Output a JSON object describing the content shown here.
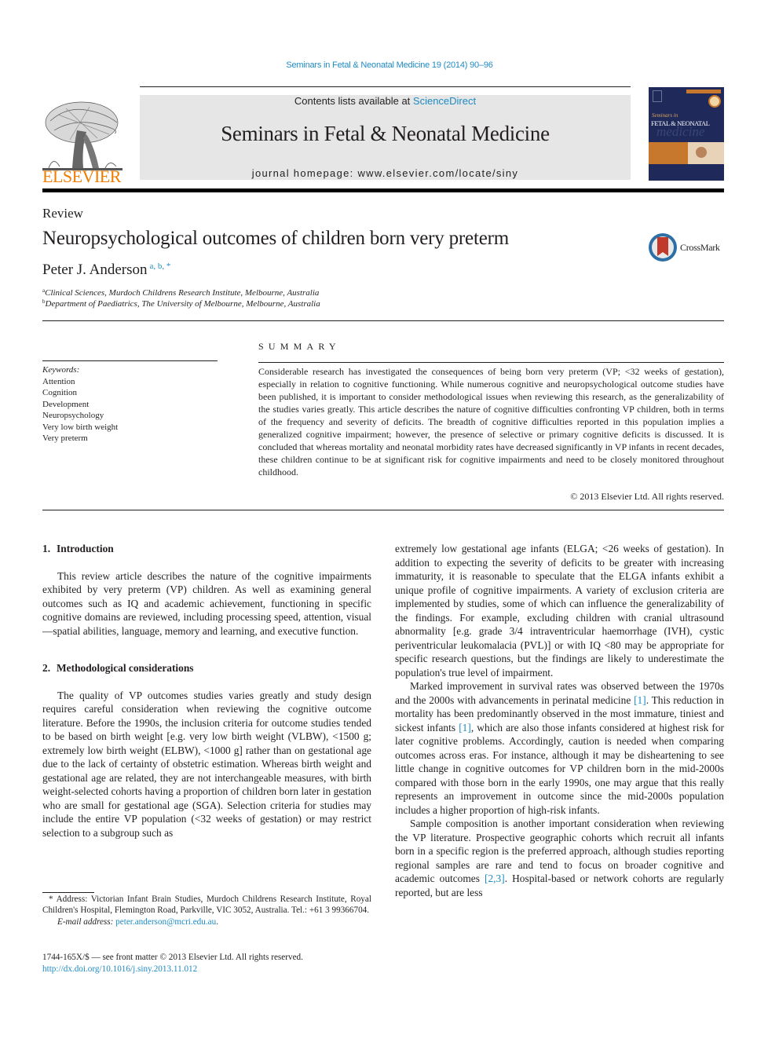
{
  "header": {
    "journal_reference": "Seminars in Fetal & Neonatal Medicine 19 (2014) 90–96",
    "contents_prefix": "Contents lists available at ",
    "contents_link": "ScienceDirect",
    "journal_title": "Seminars in Fetal & Neonatal Medicine",
    "homepage": "journal homepage: www.elsevier.com/locate/siny",
    "publisher_logo_text": "ELSEVIER",
    "cover": {
      "series_line": "Seminars in",
      "title_line": "FETAL & NEONATAL",
      "script_line": "medicine"
    },
    "colors": {
      "link": "#1e8bc3",
      "elsevier_orange": "#f07c00",
      "banner_gray": "#e6e6e6",
      "cover_navy": "#1f2a5a"
    }
  },
  "article": {
    "type": "Review",
    "title": "Neuropsychological outcomes of children born very preterm",
    "crossmark_label": "CrossMark",
    "author": "Peter J. Anderson",
    "author_marks": "a, b, *",
    "affiliations": [
      {
        "mark": "a",
        "text": "Clinical Sciences, Murdoch Childrens Research Institute, Melbourne, Australia"
      },
      {
        "mark": "b",
        "text": "Department of Paediatrics, The University of Melbourne, Melbourne, Australia"
      }
    ]
  },
  "summary": {
    "heading": "SUMMARY",
    "keywords_label": "Keywords:",
    "keywords": [
      "Attention",
      "Cognition",
      "Development",
      "Neuropsychology",
      "Very low birth weight",
      "Very preterm"
    ],
    "abstract": "Considerable research has investigated the consequences of being born very preterm (VP; <32 weeks of gestation), especially in relation to cognitive functioning. While numerous cognitive and neuropsychological outcome studies have been published, it is important to consider methodological issues when reviewing this research, as the generalizability of the studies varies greatly. This article describes the nature of cognitive difficulties confronting VP children, both in terms of the frequency and severity of deficits. The breadth of cognitive difficulties reported in this population implies a generalized cognitive impairment; however, the presence of selective or primary cognitive deficits is discussed. It is concluded that whereas mortality and neonatal morbidity rates have decreased significantly in VP infants in recent decades, these children continue to be at significant risk for cognitive impairments and need to be closely monitored throughout childhood.",
    "copyright": "© 2013 Elsevier Ltd. All rights reserved."
  },
  "body": {
    "sections": [
      {
        "number": "1.",
        "title": "Introduction",
        "paragraphs": [
          "This review article describes the nature of the cognitive impairments exhibited by very preterm (VP) children. As well as examining general outcomes such as IQ and academic achievement, functioning in specific cognitive domains are reviewed, including processing speed, attention, visual—spatial abilities, language, memory and learning, and executive function."
        ]
      },
      {
        "number": "2.",
        "title": "Methodological considerations",
        "paragraphs": [
          "The quality of VP outcomes studies varies greatly and study design requires careful consideration when reviewing the cognitive outcome literature. Before the 1990s, the inclusion criteria for outcome studies tended to be based on birth weight [e.g. very low birth weight (VLBW), <1500 g; extremely low birth weight (ELBW), <1000 g] rather than on gestational age due to the lack of certainty of obstetric estimation. Whereas birth weight and gestational age are related, they are not interchangeable measures, with birth weight-selected cohorts having a proportion of children born later in gestation who are small for gestational age (SGA). Selection criteria for studies may include the entire VP population (<32 weeks of gestation) or may restrict selection to a subgroup such as"
        ]
      }
    ],
    "right_column": {
      "p1": "extremely low gestational age infants (ELGA; <26 weeks of gestation). In addition to expecting the severity of deficits to be greater with increasing immaturity, it is reasonable to speculate that the ELGA infants exhibit a unique profile of cognitive impairments. A variety of exclusion criteria are implemented by studies, some of which can influence the generalizability of the findings. For example, excluding children with cranial ultrasound abnormality [e.g. grade 3/4 intraventricular haemorrhage (IVH), cystic periventricular leukomalacia (PVL)] or with IQ <80 may be appropriate for specific research questions, but the findings are likely to underestimate the population's true level of impairment.",
      "p2_a": "Marked improvement in survival rates was observed between the 1970s and the 2000s with advancements in perinatal medicine ",
      "p2_ref1": "[1]",
      "p2_b": ". This reduction in mortality has been predominantly observed in the most immature, tiniest and sickest infants ",
      "p2_ref2": "[1]",
      "p2_c": ", which are also those infants considered at highest risk for later cognitive problems. Accordingly, caution is needed when comparing outcomes across eras. For instance, although it may be disheartening to see little change in cognitive outcomes for VP children born in the mid-2000s compared with those born in the early 1990s, one may argue that this really represents an improvement in outcome since the mid-2000s population includes a higher proportion of high-risk infants.",
      "p3_a": "Sample composition is another important consideration when reviewing the VP literature. Prospective geographic cohorts which recruit all infants born in a specific region is the preferred approach, although studies reporting regional samples are rare and tend to focus on broader cognitive and academic outcomes ",
      "p3_ref": "[2,3]",
      "p3_b": ". Hospital-based or network cohorts are regularly reported, but are less"
    }
  },
  "footnote": {
    "mark": "*",
    "address": "Address: Victorian Infant Brain Studies, Murdoch Childrens Research Institute, Royal Children's Hospital, Flemington Road, Parkville, VIC 3052, Australia. Tel.: +61 3 99366704.",
    "email_label": "E-mail address:",
    "email": "peter.anderson@mcri.edu.au",
    "email_suffix": "."
  },
  "front_matter": {
    "issn_line": "1744-165X/$ — see front matter © 2013 Elsevier Ltd. All rights reserved.",
    "doi": "http://dx.doi.org/10.1016/j.siny.2013.11.012"
  }
}
